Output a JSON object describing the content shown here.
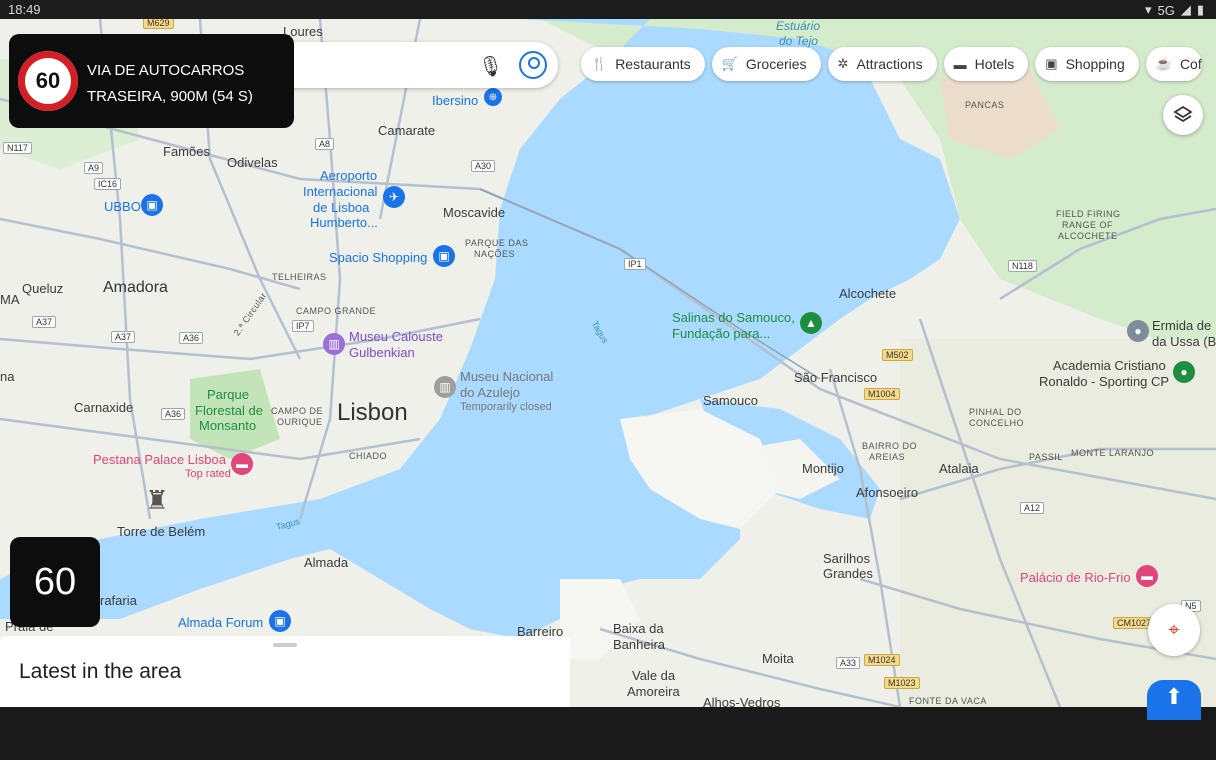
{
  "status_bar": {
    "time": "18:49",
    "network": "5G"
  },
  "search": {
    "placeholder": ""
  },
  "chips": [
    {
      "label": "Restaurants",
      "icon": "fork-knife-icon"
    },
    {
      "label": "Groceries",
      "icon": "cart-icon"
    },
    {
      "label": "Attractions",
      "icon": "ferris-wheel-icon"
    },
    {
      "label": "Hotels",
      "icon": "bed-icon"
    },
    {
      "label": "Shopping",
      "icon": "shopping-bag-icon"
    },
    {
      "label": "Cof",
      "icon": "coffee-icon"
    }
  ],
  "alert": {
    "speed_limit": "60",
    "line1": "VIA DE AUTOCARROS",
    "line2": "TRASEIRA, 900M (54 S)"
  },
  "current_speed": "60",
  "sheet": {
    "title": "Latest in the area"
  },
  "map": {
    "places": {
      "loures": "Loures",
      "camarate": "Camarate",
      "famoes": "Famões",
      "odivelas": "Odivelas",
      "moscavide": "Moscavide",
      "queluz": "Queluz",
      "amadora": "Amadora",
      "carnaxide": "Carnaxide",
      "lisbon": "Lisbon",
      "almada": "Almada",
      "torre": "Torre de Belém",
      "barreiro": "Barreiro",
      "baixa": "Baixa da",
      "banheira": "Banheira",
      "vale": "Vale da",
      "amoreira": "Amoreira",
      "alhos": "Alhos-Vedros",
      "moita": "Moita",
      "samouco": "Samouco",
      "sao_francisco": "São Francisco",
      "alcochete": "Alcochete",
      "montijo": "Montijo",
      "afonsoeiro": "Afonsoeiro",
      "atalaia": "Atalaia",
      "sarilhos1": "Sarilhos",
      "sarilhos2": "Grandes",
      "trafaria": "rafaria",
      "praia": "Praia de",
      "ma": "MA",
      "na": "na",
      "estuario1": "Estuário",
      "estuario2": "do Tejo",
      "ibersino": "Ibersino"
    },
    "small_labels": {
      "pancas": "PANCAS",
      "field1": "FIELD FIRING",
      "field2": "RANGE OF",
      "field3": "ALCOCHETE",
      "parque1": "PARQUE DAS",
      "parque2": "NAÇÕES",
      "telheiras": "TELHEIRAS",
      "campo_grande": "CAMPO GRANDE",
      "campo_ourique1": "CAMPO DE",
      "campo_ourique2": "OURIQUE",
      "chiado": "CHIADO",
      "bairro1": "BAIRRO DO",
      "bairro2": "AREIAS",
      "pinhal1": "PINHAL DO",
      "pinhal2": "CONCELHO",
      "passil": "PASSIL",
      "monte": "MONTE LARANJO",
      "fonte": "FONTE DA VACA",
      "circular": "2.ª Circular"
    },
    "water_labels": {
      "tagus1": "Tagus",
      "tagus2": "Tagus"
    },
    "pois": {
      "aeroporto": [
        "Aeroporto",
        "Internacional",
        "de Lisboa",
        "Humberto..."
      ],
      "ubbo": "UBBO",
      "spacio": "Spacio Shopping",
      "museu_gulbenkian": [
        "Museu Calouste",
        "Gulbenkian"
      ],
      "museu_azulejo": [
        "Museu Nacional",
        "do Azulejo"
      ],
      "azulejo_note": "Temporarily closed",
      "parque_monsanto": [
        "Parque",
        "Florestal de",
        "Monsanto"
      ],
      "pestana": "Pestana Palace Lisboa",
      "pestana_note": "Top rated",
      "almada_forum": "Almada Forum",
      "salinas": [
        "Salinas do Samouco,",
        "Fundação para..."
      ],
      "ermida": [
        "Ermida de",
        "da Ussa (B"
      ],
      "academia": [
        "Academia Cristiano",
        "Ronaldo - Sporting CP"
      ],
      "palacio": "Palácio de Rio-Frio"
    },
    "shields": {
      "m629": "M629",
      "n117": "N117",
      "ic16": "IC16",
      "a8": "A8",
      "a30": "A30",
      "a9": "A9",
      "ip1": "IP1",
      "a37a": "A37",
      "a37b": "A37",
      "a36a": "A36",
      "a36b": "A36",
      "ip7": "IP7",
      "n118": "N118",
      "m502": "M502",
      "m1004": "M1004",
      "a12": "A12",
      "cm1027": "CM1027",
      "n5": "N5",
      "a33": "A33",
      "m1024": "M1024",
      "m1023": "M1023"
    }
  },
  "colors": {
    "water": "#aadaff",
    "land": "#eef0e9",
    "park": "#c8e6c0",
    "road": "#b4bfd0",
    "alert_red": "#d41f25",
    "accent": "#1a73e8"
  }
}
